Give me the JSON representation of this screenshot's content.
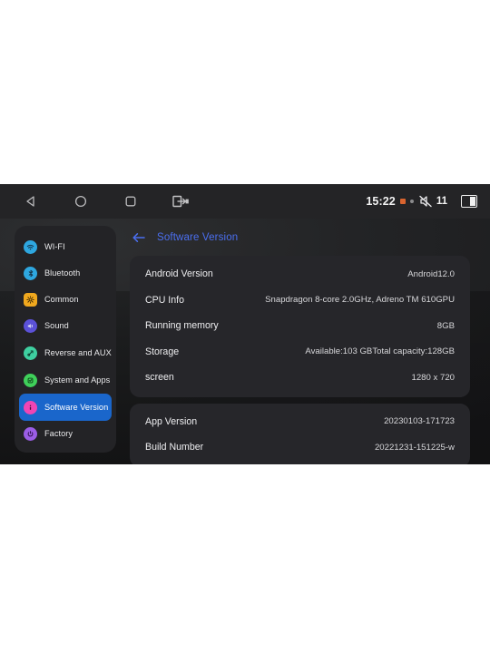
{
  "status_bar": {
    "nav": [
      {
        "name": "back",
        "icon": "back-triangle-icon"
      },
      {
        "name": "home",
        "icon": "home-circle-icon"
      },
      {
        "name": "recents",
        "icon": "recents-square-icon"
      },
      {
        "name": "exit-app",
        "icon": "exit-app-icon"
      }
    ],
    "clock": "15:22",
    "mute_count": "11",
    "indicators": [
      "orange-square-icon",
      "small-dot-icon",
      "volume-mute-icon",
      "battery-icon"
    ]
  },
  "sidebar": {
    "items": [
      {
        "label": "WI-FI",
        "icon": "wifi-icon",
        "color": "#2ea7e0",
        "shape": "circle",
        "glyph": "◎",
        "active": false
      },
      {
        "label": "Bluetooth",
        "icon": "bluetooth-icon",
        "color": "#2ea7e0",
        "shape": "circle",
        "glyph": "ᛦ",
        "active": false
      },
      {
        "label": "Common",
        "icon": "gear-icon",
        "color": "#f0a81e",
        "shape": "square",
        "glyph": "⚙",
        "active": false
      },
      {
        "label": "Sound",
        "icon": "sound-icon",
        "color": "#5b51d8",
        "shape": "circle",
        "glyph": "◂",
        "active": false
      },
      {
        "label": "Reverse and AUX",
        "icon": "reverse-aux-icon",
        "color": "#3ecfa0",
        "shape": "circle",
        "glyph": "⌘",
        "active": false
      },
      {
        "label": "System and Apps",
        "icon": "system-apps-icon",
        "color": "#3fd05a",
        "shape": "circle",
        "glyph": "◳",
        "active": false
      },
      {
        "label": "Software Version",
        "icon": "info-icon",
        "color": "#f045b4",
        "shape": "circle",
        "glyph": "i",
        "active": true
      },
      {
        "label": "Factory",
        "icon": "factory-icon",
        "color": "#9b5de5",
        "shape": "circle",
        "glyph": "⏻",
        "active": false
      }
    ]
  },
  "header": {
    "back_icon": "back-arrow-icon",
    "title": "Software Version",
    "accent_color": "#4b6ff0"
  },
  "main": {
    "card_one": [
      {
        "label": "Android Version",
        "value": "Android12.0"
      },
      {
        "label": "CPU Info",
        "value": "Snapdragon 8-core 2.0GHz, Adreno TM 610GPU"
      },
      {
        "label": "Running memory",
        "value": "8GB"
      },
      {
        "label": "Storage",
        "value": "Available:103 GBTotal capacity:128GB"
      },
      {
        "label": "screen",
        "value": "1280 x 720"
      }
    ],
    "card_two": [
      {
        "label": "App Version",
        "value": "20230103-171723"
      },
      {
        "label": "Build Number",
        "value": "20221231-151225-w"
      }
    ]
  }
}
